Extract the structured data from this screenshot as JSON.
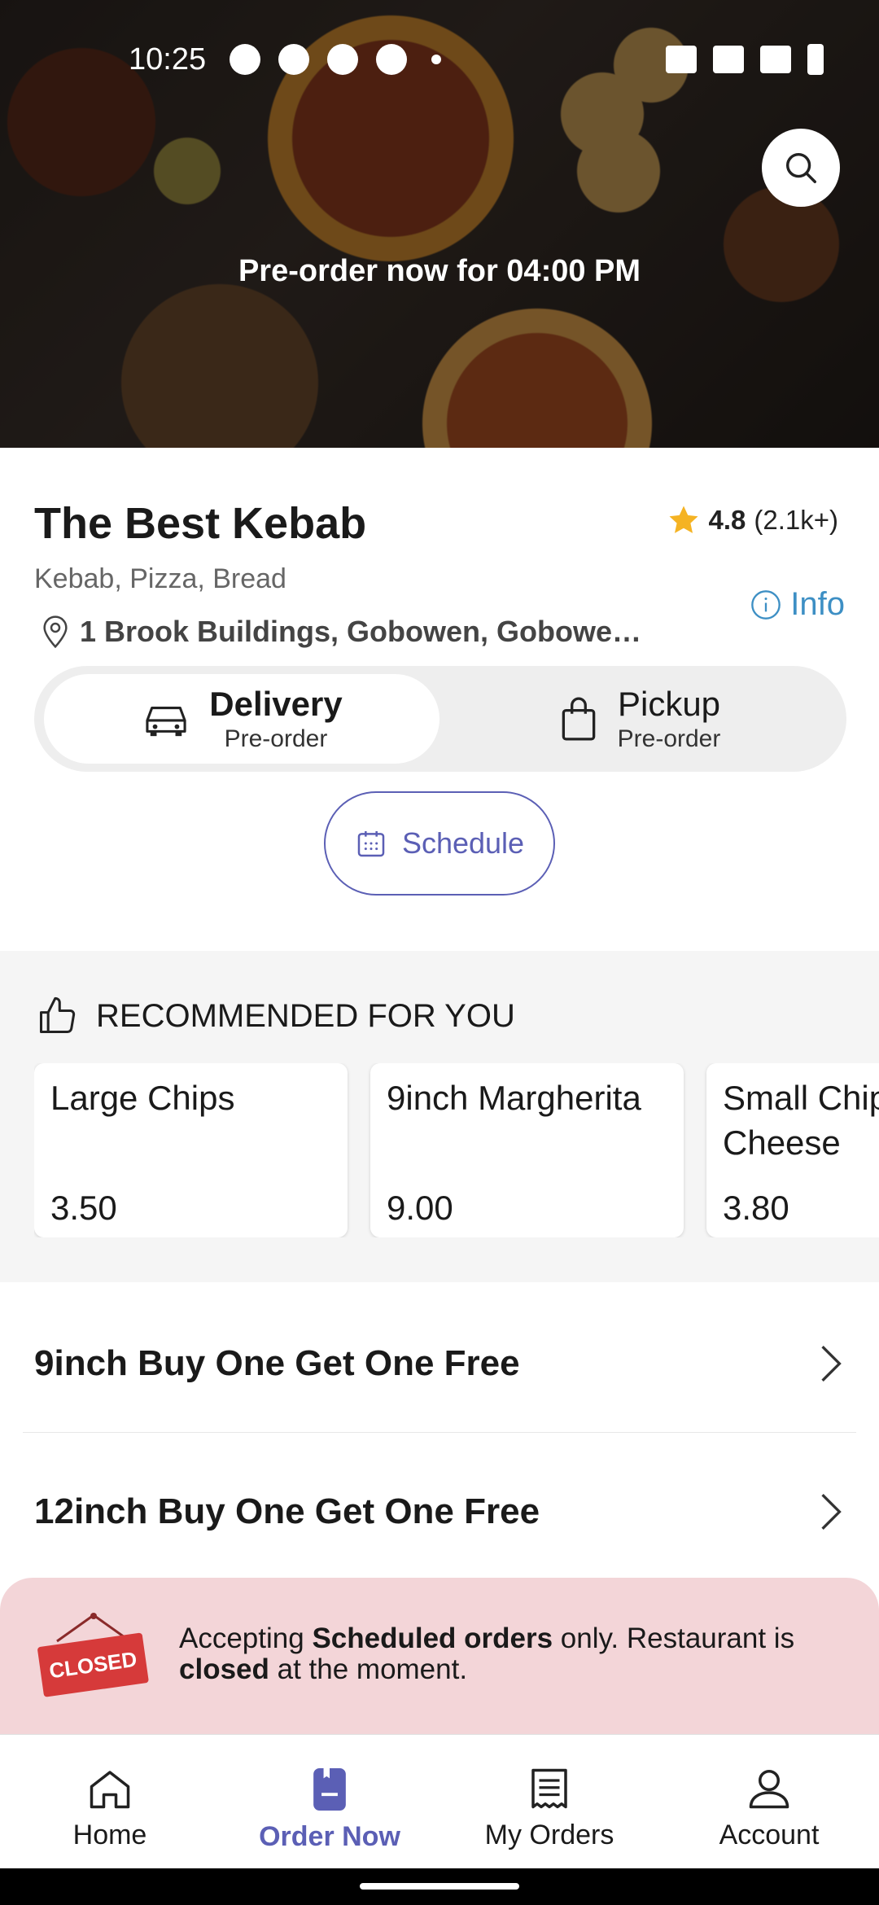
{
  "status_bar": {
    "time": "10:25"
  },
  "hero": {
    "preorder_text": "Pre-order now for 04:00 PM"
  },
  "restaurant": {
    "name": "The Best Kebab",
    "rating": "4.8",
    "rating_count": "(2.1k+)",
    "cuisine": "Kebab, Pizza, Bread",
    "address": "1 Brook Buildings, Gobowen, Gobowe…",
    "info_label": "Info"
  },
  "order_mode": {
    "delivery": {
      "title": "Delivery",
      "subtitle": "Pre-order"
    },
    "pickup": {
      "title": "Pickup",
      "subtitle": "Pre-order"
    }
  },
  "schedule_label": "Schedule",
  "recommended": {
    "heading": "RECOMMENDED FOR YOU",
    "items": [
      {
        "name": "Large Chips",
        "price": "3.50"
      },
      {
        "name": "9inch Margherita",
        "price": "9.00"
      },
      {
        "name": "Small Chips Cheese",
        "price": "3.80"
      }
    ]
  },
  "categories": [
    {
      "label": "9inch Buy One Get One Free"
    },
    {
      "label": "12inch Buy One Get One Free"
    }
  ],
  "closed_banner": {
    "sign_text": "CLOSED",
    "text_1": "Accepting ",
    "bold_1": "Scheduled orders",
    "text_2": " only. Restaurant is ",
    "bold_2": "closed",
    "text_3": " at the moment."
  },
  "bottom_nav": [
    {
      "label": "Home",
      "icon": "home-icon"
    },
    {
      "label": "Order Now",
      "icon": "order-now-icon"
    },
    {
      "label": "My Orders",
      "icon": "receipt-icon"
    },
    {
      "label": "Account",
      "icon": "user-icon"
    }
  ],
  "colors": {
    "accent": "#5b5fb5",
    "info": "#3d8fc4",
    "star": "#f5b323",
    "closed_bg": "#f3d5d8",
    "closed_sign": "#d63a3a"
  }
}
